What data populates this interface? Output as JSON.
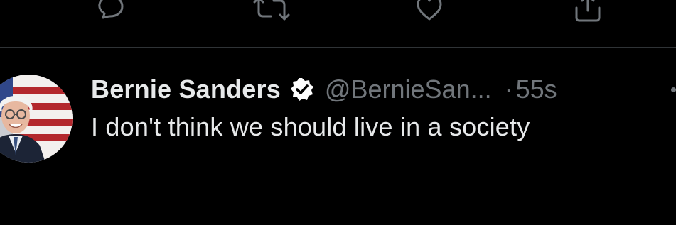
{
  "actions": {
    "reply_icon": "reply-icon",
    "retweet_icon": "retweet-icon",
    "like_icon": "like-icon",
    "share_icon": "share-icon"
  },
  "tweet": {
    "display_name": "Bernie Sanders",
    "verified": true,
    "handle": "@BernieSan...",
    "separator": "·",
    "timestamp": "55s",
    "text": "I don't think we should live in a society"
  },
  "colors": {
    "background": "#000000",
    "primary_text": "#e7e9ea",
    "secondary_text": "#71767b",
    "divider": "#2f3336"
  }
}
